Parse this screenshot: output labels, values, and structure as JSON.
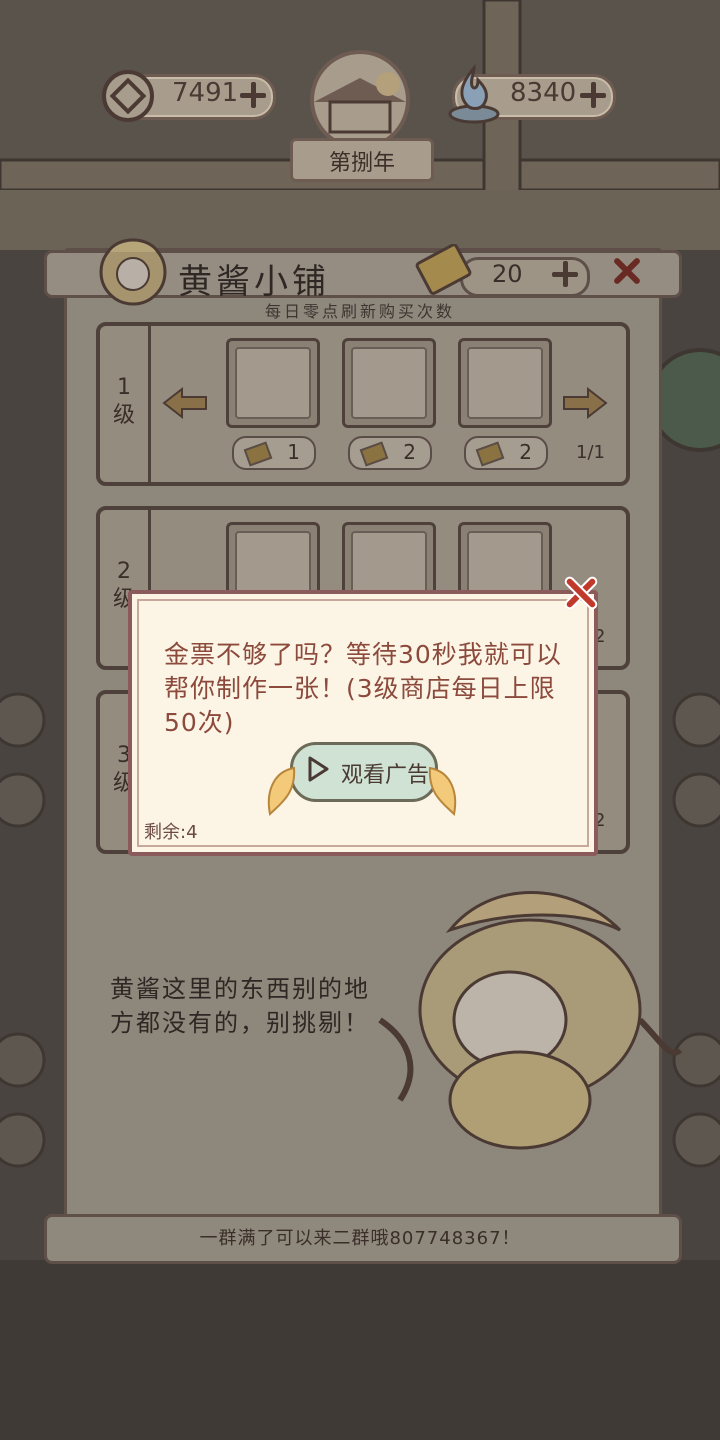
{
  "top_bar": {
    "coins": "7491",
    "spirit": "8340",
    "year_label": "第捌年"
  },
  "shop": {
    "title": "黄酱小铺",
    "subtitle": "每日零点刷新购买次数",
    "tickets": "20",
    "tiers": [
      {
        "label": "1级",
        "page": "1/1",
        "prices": [
          "1",
          "2",
          "2"
        ]
      },
      {
        "label": "2级",
        "page": "2"
      },
      {
        "label": "3级",
        "page": "2"
      }
    ],
    "npc_speech": "黄酱这里的东西别的地方都没有的，别挑剔！",
    "footer": "一群满了可以来二群哦807748367！"
  },
  "dialog": {
    "message": "金票不够了吗？等待30秒我就可以帮你制作一张！(3级商店每日上限50次)",
    "button_label": "观看广告",
    "remaining": "剩余:4"
  },
  "colors": {
    "dialog_bg": "#fcf4e5",
    "dialog_text": "#8b4a3c",
    "close_red": "#c0392b",
    "ad_button": "#cfe2d3"
  },
  "icons": {
    "coin": "square-hole-coin-icon",
    "spirit": "blue-flame-icon",
    "close": "close-x-icon",
    "play": "play-triangle-icon",
    "ticket": "gold-ticket-icon",
    "arrow_left": "arrow-left-icon",
    "arrow_right": "arrow-right-icon"
  }
}
